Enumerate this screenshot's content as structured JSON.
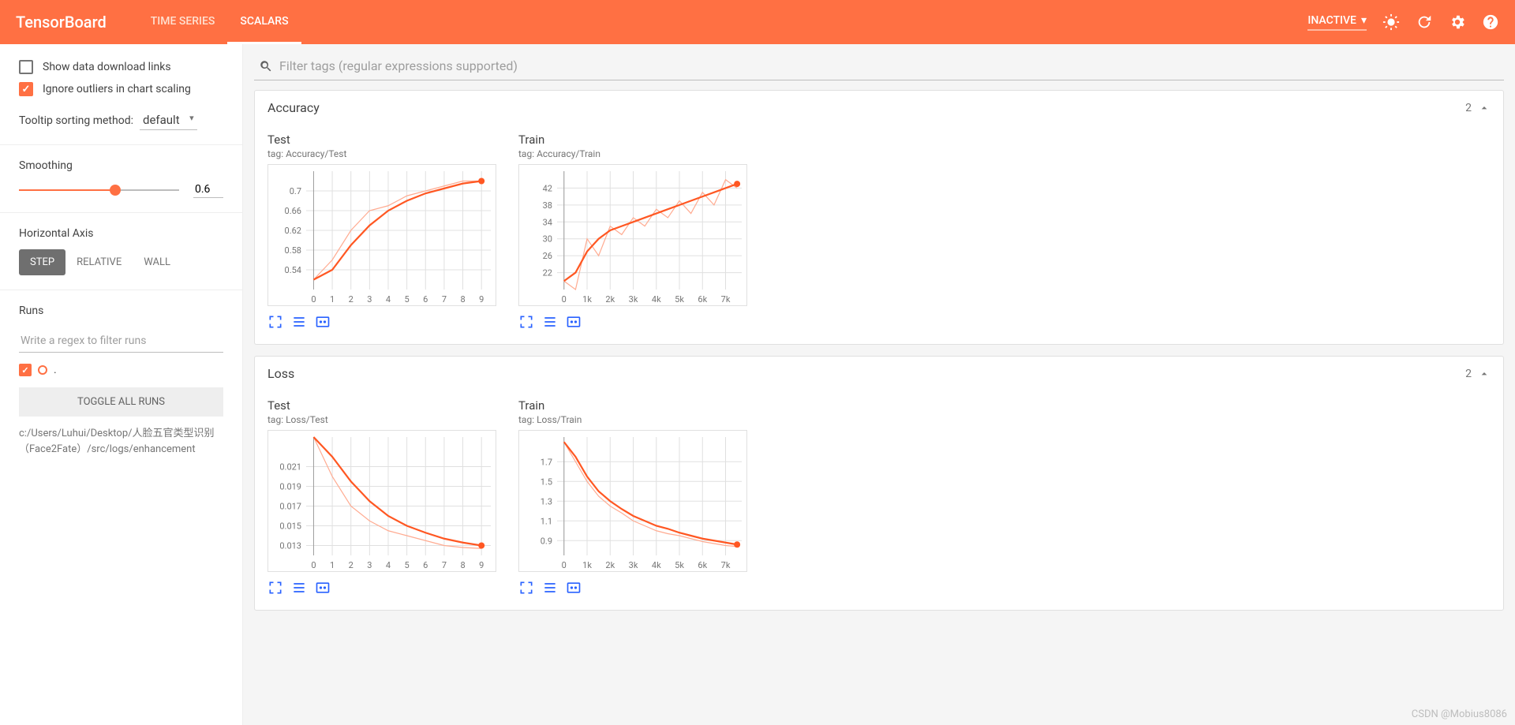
{
  "header": {
    "logo": "TensorBoard",
    "tabs": [
      {
        "label": "TIME SERIES",
        "active": false
      },
      {
        "label": "SCALARS",
        "active": true
      }
    ],
    "inactive_label": "INACTIVE"
  },
  "sidebar": {
    "show_download": {
      "label": "Show data download links",
      "checked": false
    },
    "ignore_outliers": {
      "label": "Ignore outliers in chart scaling",
      "checked": true
    },
    "tooltip_label": "Tooltip sorting method:",
    "tooltip_value": "default",
    "smoothing_label": "Smoothing",
    "smoothing_value": "0.6",
    "smoothing_percent": 60,
    "haxis_label": "Horizontal Axis",
    "haxis_options": [
      {
        "label": "STEP",
        "active": true
      },
      {
        "label": "RELATIVE",
        "active": false
      },
      {
        "label": "WALL",
        "active": false
      }
    ],
    "runs_label": "Runs",
    "runs_placeholder": "Write a regex to filter runs",
    "run_name": ".",
    "toggle_runs": "TOGGLE ALL RUNS",
    "logdir": "c:/Users/Luhui/Desktop/人脸五官类型识别（Face2Fate）/src/logs/enhancement"
  },
  "filter": {
    "placeholder": "Filter tags (regular expressions supported)"
  },
  "categories": [
    {
      "title": "Accuracy",
      "count": "2",
      "charts": [
        "accuracy_test",
        "accuracy_train"
      ]
    },
    {
      "title": "Loss",
      "count": "2",
      "charts": [
        "loss_test",
        "loss_train"
      ]
    }
  ],
  "chart_data": [
    {
      "id": "accuracy_test",
      "title": "Test",
      "tag": "tag: Accuracy/Test",
      "type": "line",
      "x": [
        0,
        1,
        2,
        3,
        4,
        5,
        6,
        7,
        8,
        9
      ],
      "series": [
        {
          "name": "smoothed",
          "values": [
            0.52,
            0.54,
            0.59,
            0.63,
            0.66,
            0.68,
            0.695,
            0.705,
            0.715,
            0.72
          ]
        },
        {
          "name": "raw",
          "values": [
            0.52,
            0.56,
            0.62,
            0.66,
            0.67,
            0.69,
            0.7,
            0.71,
            0.72,
            0.72
          ]
        }
      ],
      "y_ticks": [
        0.54,
        0.58,
        0.62,
        0.66,
        0.7
      ],
      "x_ticks": [
        0,
        1,
        2,
        3,
        4,
        5,
        6,
        7,
        8,
        9
      ],
      "xlim": [
        -0.4,
        9.5
      ],
      "ylim": [
        0.5,
        0.74
      ]
    },
    {
      "id": "accuracy_train",
      "title": "Train",
      "tag": "tag: Accuracy/Train",
      "type": "line",
      "x": [
        0,
        500,
        1000,
        1500,
        2000,
        2500,
        3000,
        3500,
        4000,
        4500,
        5000,
        5500,
        6000,
        6500,
        7000,
        7500
      ],
      "series": [
        {
          "name": "smoothed",
          "values": [
            20,
            22,
            27,
            30,
            32,
            33,
            34,
            35,
            36,
            37,
            38,
            39,
            40,
            41,
            42,
            43
          ]
        },
        {
          "name": "raw",
          "values": [
            20,
            18,
            30,
            26,
            33,
            31,
            35,
            33,
            37,
            35,
            39,
            36,
            41,
            38,
            44,
            42
          ]
        }
      ],
      "y_ticks": [
        22,
        26,
        30,
        34,
        38,
        42
      ],
      "x_ticks": [
        "0",
        "1k",
        "2k",
        "3k",
        "4k",
        "5k",
        "6k",
        "7k"
      ],
      "xlim": [
        -300,
        7700
      ],
      "ylim": [
        18,
        46
      ]
    },
    {
      "id": "loss_test",
      "title": "Test",
      "tag": "tag: Loss/Test",
      "type": "line",
      "x": [
        0,
        1,
        2,
        3,
        4,
        5,
        6,
        7,
        8,
        9
      ],
      "series": [
        {
          "name": "smoothed",
          "values": [
            0.024,
            0.022,
            0.0195,
            0.0175,
            0.016,
            0.015,
            0.0143,
            0.0137,
            0.0133,
            0.013
          ]
        },
        {
          "name": "raw",
          "values": [
            0.024,
            0.02,
            0.017,
            0.0155,
            0.0145,
            0.014,
            0.0135,
            0.013,
            0.0128,
            0.0127
          ]
        }
      ],
      "y_ticks": [
        0.013,
        0.015,
        0.017,
        0.019,
        0.021
      ],
      "x_ticks": [
        0,
        1,
        2,
        3,
        4,
        5,
        6,
        7,
        8,
        9
      ],
      "xlim": [
        -0.4,
        9.5
      ],
      "ylim": [
        0.012,
        0.024
      ]
    },
    {
      "id": "loss_train",
      "title": "Train",
      "tag": "tag: Loss/Train",
      "type": "line",
      "x": [
        0,
        500,
        1000,
        1500,
        2000,
        2500,
        3000,
        3500,
        4000,
        4500,
        5000,
        5500,
        6000,
        6500,
        7000,
        7500
      ],
      "series": [
        {
          "name": "smoothed",
          "values": [
            1.9,
            1.75,
            1.55,
            1.4,
            1.3,
            1.22,
            1.15,
            1.1,
            1.05,
            1.02,
            0.98,
            0.95,
            0.92,
            0.9,
            0.88,
            0.86
          ]
        },
        {
          "name": "raw",
          "values": [
            1.9,
            1.7,
            1.5,
            1.35,
            1.25,
            1.18,
            1.1,
            1.05,
            1.0,
            0.97,
            0.95,
            0.92,
            0.89,
            0.87,
            0.85,
            0.84
          ]
        }
      ],
      "y_ticks": [
        0.9,
        1.1,
        1.3,
        1.5,
        1.7
      ],
      "x_ticks": [
        "0",
        "1k",
        "2k",
        "3k",
        "4k",
        "5k",
        "6k",
        "7k"
      ],
      "xlim": [
        -300,
        7700
      ],
      "ylim": [
        0.75,
        1.95
      ]
    }
  ],
  "watermark": "CSDN @Mobius8086"
}
